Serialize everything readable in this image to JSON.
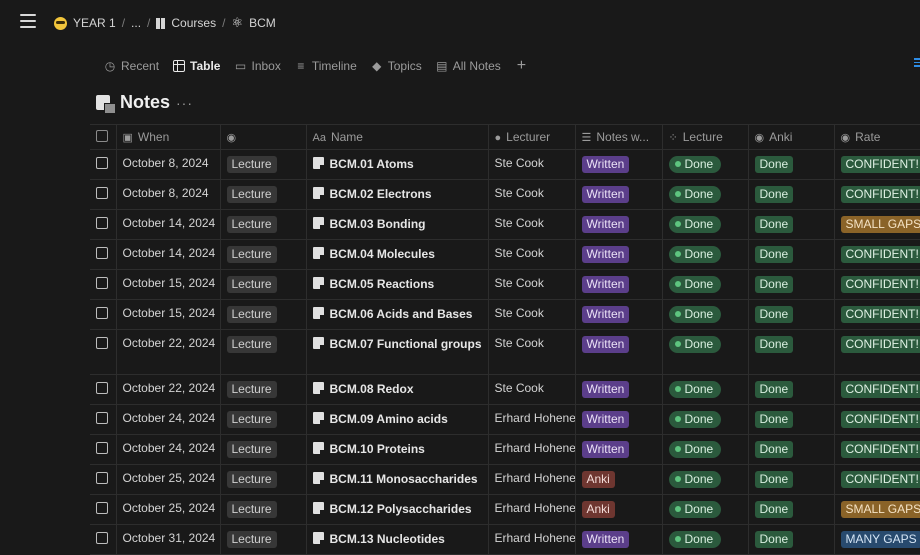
{
  "breadcrumb": {
    "items": [
      "YEAR 1",
      "...",
      "Courses",
      "BCM"
    ],
    "separator": "/"
  },
  "tabs": [
    {
      "label": "Recent",
      "icon": "clock-icon"
    },
    {
      "label": "Table",
      "icon": "table-icon",
      "active": true
    },
    {
      "label": "Inbox",
      "icon": "inbox-icon"
    },
    {
      "label": "Timeline",
      "icon": "timeline-icon"
    },
    {
      "label": "Topics",
      "icon": "tag-icon"
    },
    {
      "label": "All Notes",
      "icon": "notes-icon"
    }
  ],
  "database": {
    "title": "Notes",
    "more": "···"
  },
  "columns": {
    "when": "When",
    "type_icon": "",
    "name": "Name",
    "lecturer": "Lecturer",
    "notes": "Notes w...",
    "lecture": "Lecture",
    "anki": "Anki",
    "rate": "Rate"
  },
  "rows": [
    {
      "date": "October 8, 2024",
      "type": "Lecture",
      "name": "BCM.01 Atoms",
      "lecturer": "Ste Cook",
      "notes": "Written",
      "lecture": "Done",
      "anki": "Done",
      "rate": "CONFIDENT!"
    },
    {
      "date": "October 8, 2024",
      "type": "Lecture",
      "name": "BCM.02 Electrons",
      "lecturer": "Ste Cook",
      "notes": "Written",
      "lecture": "Done",
      "anki": "Done",
      "rate": "CONFIDENT!"
    },
    {
      "date": "October 14, 2024",
      "type": "Lecture",
      "name": "BCM.03 Bonding",
      "lecturer": "Ste Cook",
      "notes": "Written",
      "lecture": "Done",
      "anki": "Done",
      "rate": "SMALL GAPS"
    },
    {
      "date": "October 14, 2024",
      "type": "Lecture",
      "name": "BCM.04 Molecules",
      "lecturer": "Ste Cook",
      "notes": "Written",
      "lecture": "Done",
      "anki": "Done",
      "rate": "CONFIDENT!"
    },
    {
      "date": "October 15, 2024",
      "type": "Lecture",
      "name": "BCM.05 Reactions",
      "lecturer": "Ste Cook",
      "notes": "Written",
      "lecture": "Done",
      "anki": "Done",
      "rate": "CONFIDENT!"
    },
    {
      "date": "October 15, 2024",
      "type": "Lecture",
      "name": "BCM.06 Acids and Bases",
      "lecturer": "Ste Cook",
      "notes": "Written",
      "lecture": "Done",
      "anki": "Done",
      "rate": "CONFIDENT!"
    },
    {
      "date": "October 22, 2024",
      "type": "Lecture",
      "name": "BCM.07 Functional groups",
      "lecturer": "Ste Cook",
      "notes": "Written",
      "lecture": "Done",
      "anki": "Done",
      "rate": "CONFIDENT!"
    },
    {
      "date": "October 22, 2024",
      "type": "Lecture",
      "name": "BCM.08 Redox",
      "lecturer": "Ste Cook",
      "notes": "Written",
      "lecture": "Done",
      "anki": "Done",
      "rate": "CONFIDENT!"
    },
    {
      "date": "October 24, 2024",
      "type": "Lecture",
      "name": "BCM.09 Amino acids",
      "lecturer": "Erhard Hohene",
      "notes": "Written",
      "lecture": "Done",
      "anki": "Done",
      "rate": "CONFIDENT!"
    },
    {
      "date": "October 24, 2024",
      "type": "Lecture",
      "name": "BCM.10 Proteins",
      "lecturer": "Erhard Hohene",
      "notes": "Written",
      "lecture": "Done",
      "anki": "Done",
      "rate": "CONFIDENT!"
    },
    {
      "date": "October 25, 2024",
      "type": "Lecture",
      "name": "BCM.11 Monosaccharides",
      "lecturer": "Erhard Hohene",
      "notes": "Anki",
      "lecture": "Done",
      "anki": "Done",
      "rate": "CONFIDENT!"
    },
    {
      "date": "October 25, 2024",
      "type": "Lecture",
      "name": "BCM.12 Polysaccharides",
      "lecturer": "Erhard Hohene",
      "notes": "Anki",
      "lecture": "Done",
      "anki": "Done",
      "rate": "SMALL GAPS"
    },
    {
      "date": "October 31, 2024",
      "type": "Lecture",
      "name": "BCM.13 Nucleotides",
      "lecturer": "Erhard Hohene",
      "notes": "Written",
      "lecture": "Done",
      "anki": "Done",
      "rate": "MANY GAPS"
    }
  ],
  "colors": {
    "background": "#191919",
    "written": "#5b3e8a",
    "anki": "#6e3630",
    "done": "#2b5a3d",
    "small_gaps": "#8a6328",
    "many_gaps": "#284a6e",
    "accent": "#2e8de6"
  }
}
